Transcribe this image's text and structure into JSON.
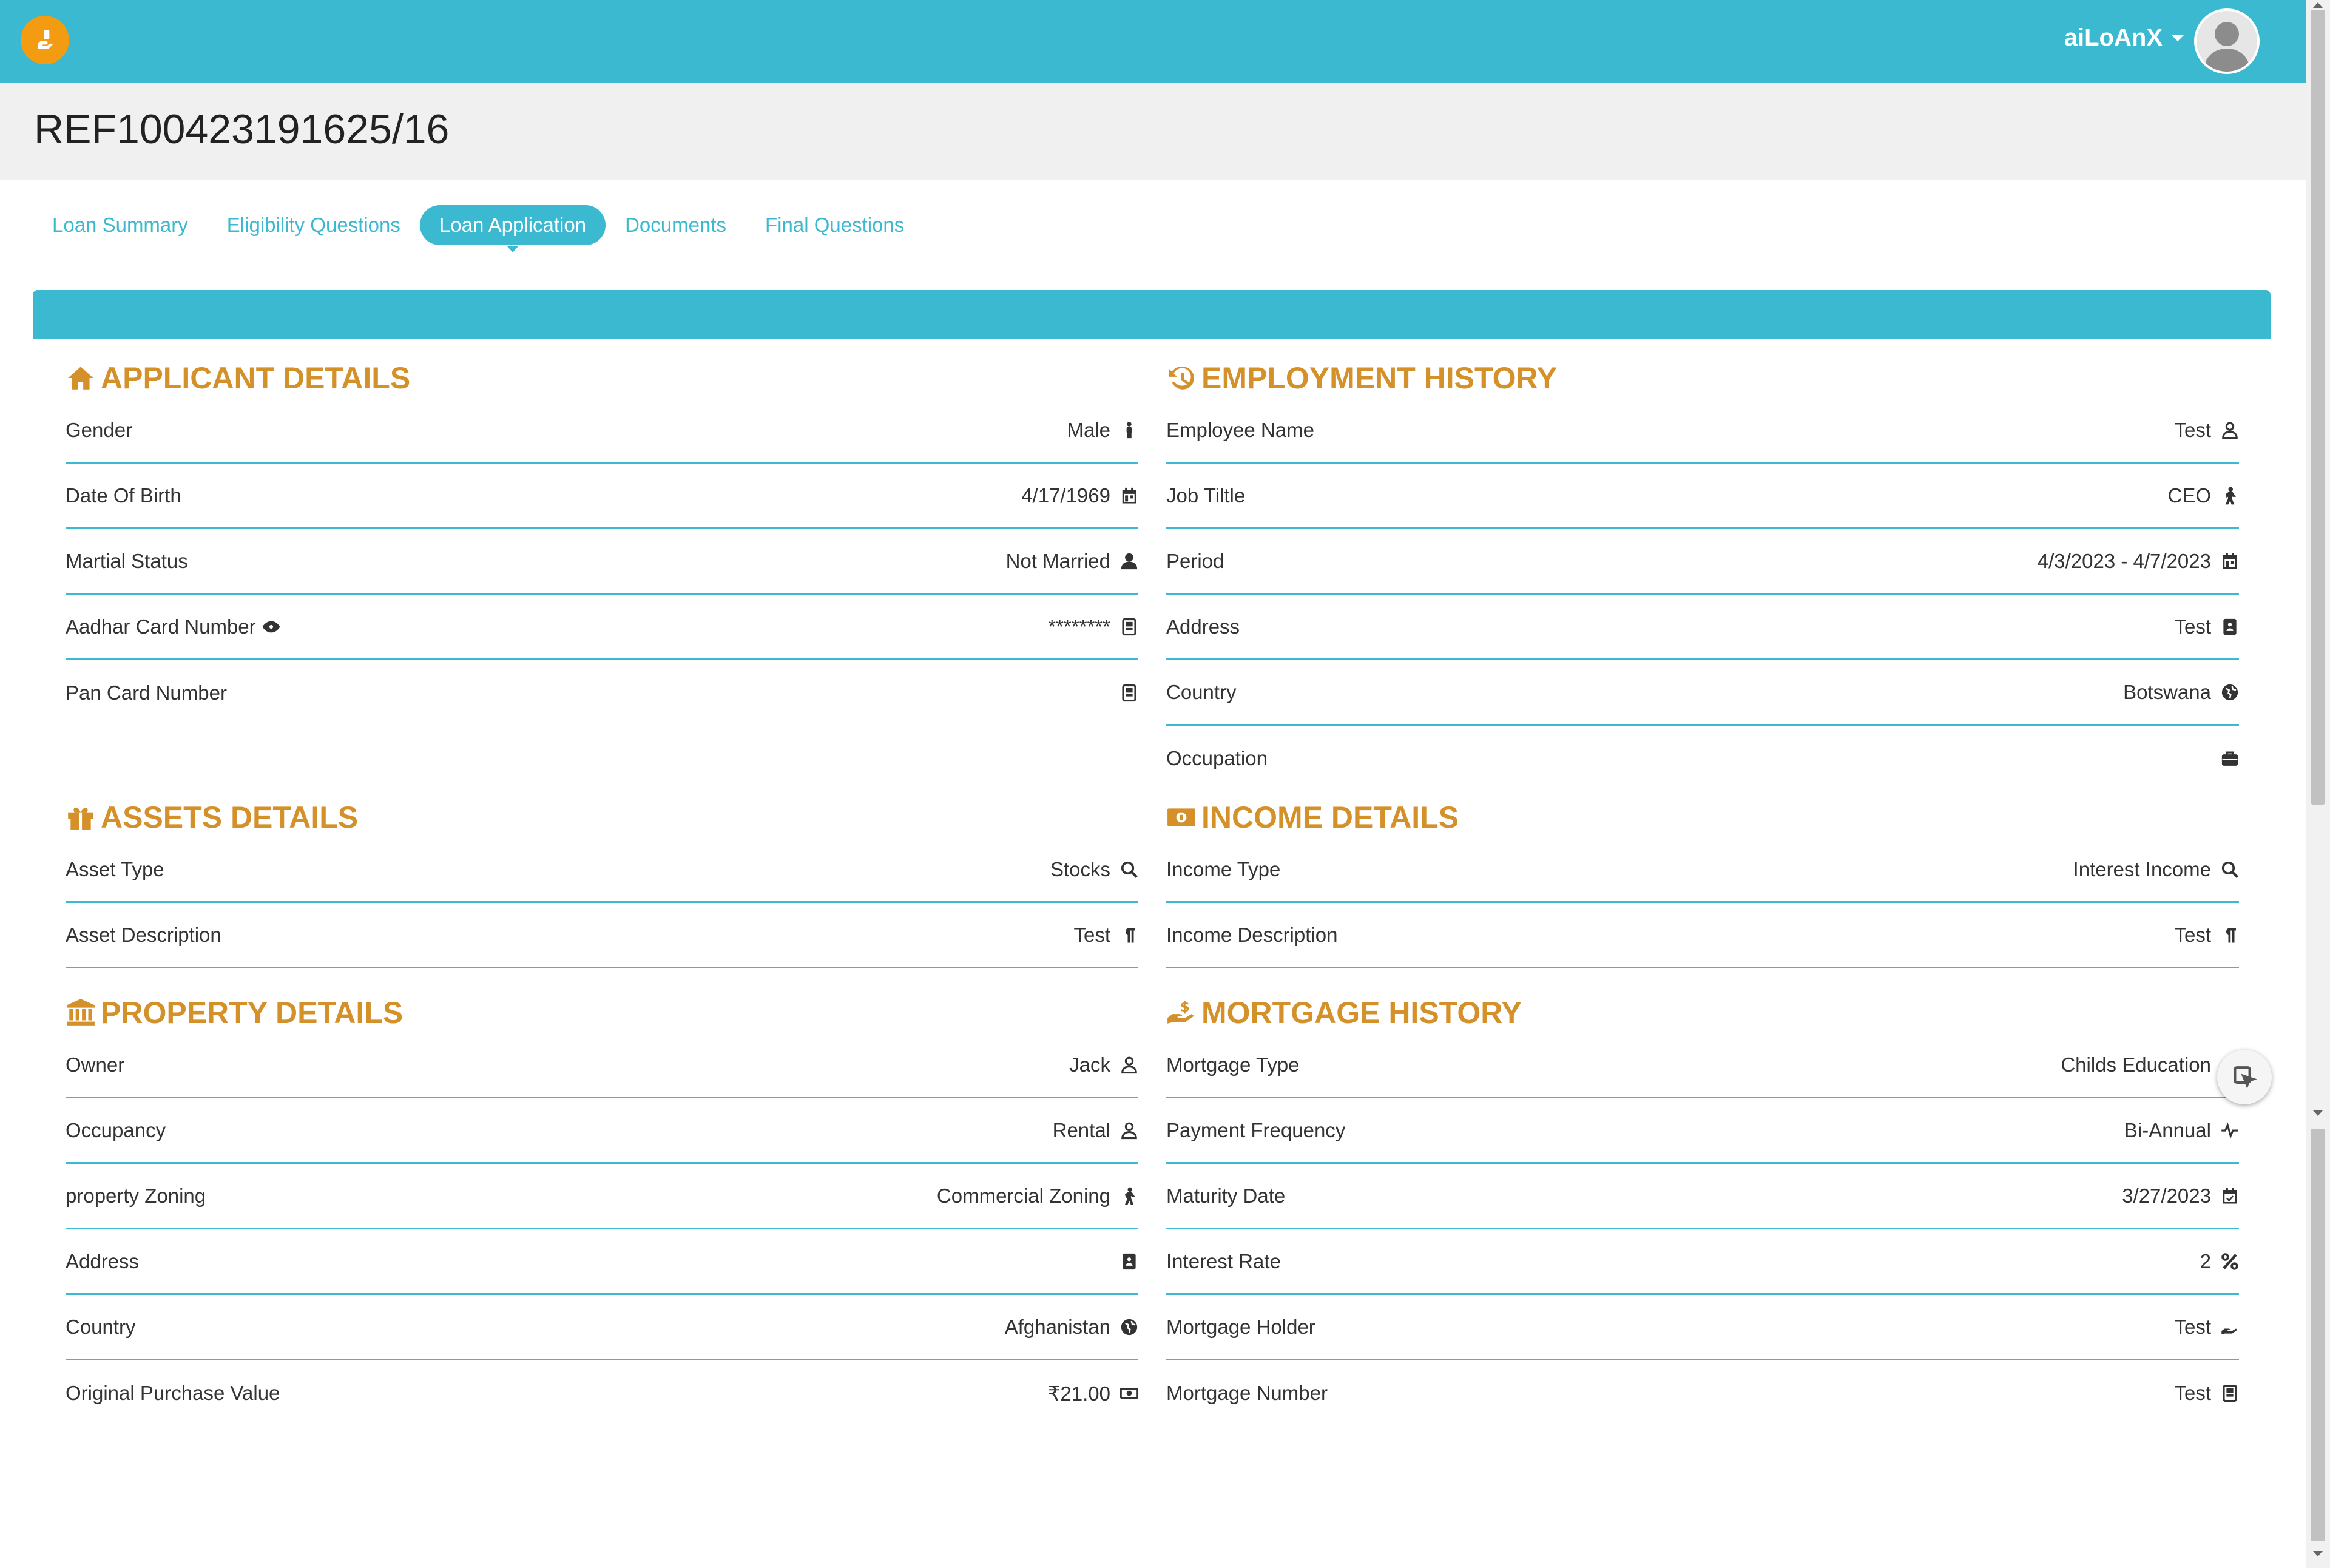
{
  "header": {
    "user_name": "aiLoAnX"
  },
  "ref_title": "REF100423191625/16",
  "tabs": [
    {
      "label": "Loan Summary"
    },
    {
      "label": "Eligibility Questions"
    },
    {
      "label": "Loan Application"
    },
    {
      "label": "Documents"
    },
    {
      "label": "Final Questions"
    }
  ],
  "active_tab": "Loan Application",
  "colors": {
    "accent": "#3bb9d0",
    "section_heading": "#d4912a",
    "logo": "#f39c12"
  },
  "applicant": {
    "title": "APPLICANT DETAILS",
    "rows": [
      {
        "label": "Gender",
        "value": "Male",
        "icon": "male-icon"
      },
      {
        "label": "Date Of Birth",
        "value": "4/17/1969",
        "icon": "calendar-icon"
      },
      {
        "label": "Martial Status",
        "value": "Not Married",
        "icon": "user-icon"
      },
      {
        "label": "Aadhar Card Number",
        "value": "********",
        "icon": "id-card-icon"
      },
      {
        "label": "Pan Card Number",
        "value": "",
        "icon": "id-card-icon"
      }
    ]
  },
  "employment": {
    "title": "EMPLOYMENT HISTORY",
    "rows": [
      {
        "label": "Employee Name",
        "value": "Test",
        "icon": "user-outline-icon"
      },
      {
        "label": "Job Tiltle",
        "value": "CEO",
        "icon": "walking-icon"
      },
      {
        "label": "Period",
        "value": "4/3/2023 - 4/7/2023",
        "icon": "calendar-icon"
      },
      {
        "label": "Address",
        "value": "Test",
        "icon": "address-book-icon"
      },
      {
        "label": "Country",
        "value": "Botswana",
        "icon": "globe-icon"
      },
      {
        "label": "Occupation",
        "value": "",
        "icon": "briefcase-icon"
      }
    ]
  },
  "assets": {
    "title": "ASSETS DETAILS",
    "rows": [
      {
        "label": "Asset Type",
        "value": "Stocks",
        "icon": "search-icon"
      },
      {
        "label": "Asset Description",
        "value": "Test",
        "icon": "paragraph-icon"
      }
    ]
  },
  "income": {
    "title": "INCOME DETAILS",
    "rows": [
      {
        "label": "Income Type",
        "value": "Interest Income",
        "icon": "search-icon"
      },
      {
        "label": "Income Description",
        "value": "Test",
        "icon": "paragraph-icon"
      }
    ]
  },
  "property": {
    "title": "PROPERTY DETAILS",
    "rows": [
      {
        "label": "Owner",
        "value": "Jack",
        "icon": "user-outline-icon"
      },
      {
        "label": "Occupancy",
        "value": "Rental",
        "icon": "user-outline-icon"
      },
      {
        "label": "property Zoning",
        "value": "Commercial Zoning",
        "icon": "walking-icon"
      },
      {
        "label": "Address",
        "value": "",
        "icon": "address-book-icon"
      },
      {
        "label": "Country",
        "value": "Afghanistan",
        "icon": "globe-icon"
      },
      {
        "label": "Original Purchase Value",
        "value": "₹21.00",
        "icon": "money-icon"
      }
    ]
  },
  "mortgage": {
    "title": "MORTGAGE HISTORY",
    "rows": [
      {
        "label": "Mortgage Type",
        "value": "Childs Education",
        "icon": "graduation-icon"
      },
      {
        "label": "Payment Frequency",
        "value": "Bi-Annual",
        "icon": "pulse-icon"
      },
      {
        "label": "Maturity Date",
        "value": "3/27/2023",
        "icon": "calendar-check-icon"
      },
      {
        "label": "Interest Rate",
        "value": "2",
        "icon": "percent-icon"
      },
      {
        "label": "Mortgage Holder",
        "value": "Test",
        "icon": "hand-holding-icon"
      },
      {
        "label": "Mortgage Number",
        "value": "Test",
        "icon": "id-card-icon"
      }
    ]
  }
}
